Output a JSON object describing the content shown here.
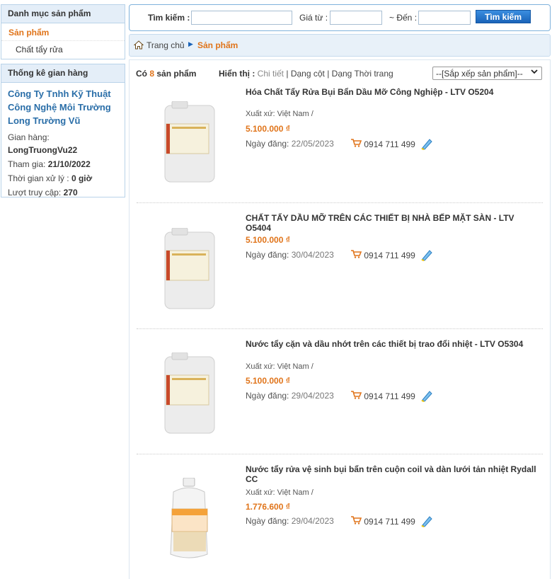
{
  "sidebar": {
    "category_title": "Danh mục sản phẩm",
    "cat_main": "Sản phẩm",
    "cat_sub": "Chất tẩy rửa",
    "stats_title": "Thống kê gian hàng",
    "shop_name": "Công Ty Tnhh Kỹ Thuật Công Nghệ Môi Trường Long Trường Vũ",
    "shop_label": "Gian hàng:",
    "shop_id": "LongTruongVu22",
    "join_label": "Tham gia:",
    "join_date": "21/10/2022",
    "process_label": "Thời gian xử lý :",
    "process_value": "0 giờ",
    "visits_label": "Lượt truy cập:",
    "visits_value": "270"
  },
  "search": {
    "label": "Tìm kiếm :",
    "price_from_label": "Giá từ :",
    "price_to_label": "~ Đến :",
    "button": "Tìm kiếm",
    "query": "",
    "price_from": "",
    "price_to": ""
  },
  "breadcrumb": {
    "home": "Trang chủ",
    "current": "Sản phẩm"
  },
  "list": {
    "count_prefix": "Có",
    "count": "8",
    "count_suffix": "sản phẩm",
    "view_label": "Hiển thị :",
    "view_detail": "Chi tiết",
    "view_column": "Dạng cột",
    "view_fashion": "Dạng Thời trang",
    "sort_label": "--[Sắp xếp sản phẩm]--",
    "date_label": "Ngày đăng:"
  },
  "products": [
    {
      "title": "Hóa Chất Tẩy Rửa Bụi Bẩn Dầu Mỡ Công Nghiệp - LTV O5204",
      "origin": "Xuất xứ: Việt Nam /",
      "price": "5.100.000 ₫",
      "date": "22/05/2023",
      "phone": "0914 711 499"
    },
    {
      "title": "CHẤT TẨY DẦU MỠ TRÊN CÁC THIẾT BỊ NHÀ BẾP MẶT SÀN - LTV O5404",
      "origin": "",
      "price": "5.100.000 ₫",
      "date": "30/04/2023",
      "phone": "0914 711 499"
    },
    {
      "title": "Nước tẩy cặn và dầu nhớt trên các thiết bị trao đổi nhiệt - LTV O5304",
      "origin": "Xuất xứ: Việt Nam /",
      "price": "5.100.000 ₫",
      "date": "29/04/2023",
      "phone": "0914 711 499"
    },
    {
      "title": "Nước tẩy rửa vệ sinh bụi bẩn trên cuộn coil và dàn lưới tản nhiệt Rydall CC",
      "origin": "Xuất xứ: Việt Nam /",
      "price": "1.776.600 ₫",
      "date": "29/04/2023",
      "phone": "0914 711 499"
    }
  ],
  "colors": {
    "accent": "#e0741a",
    "link": "#2a6ea8",
    "button": "#1a63b8"
  }
}
